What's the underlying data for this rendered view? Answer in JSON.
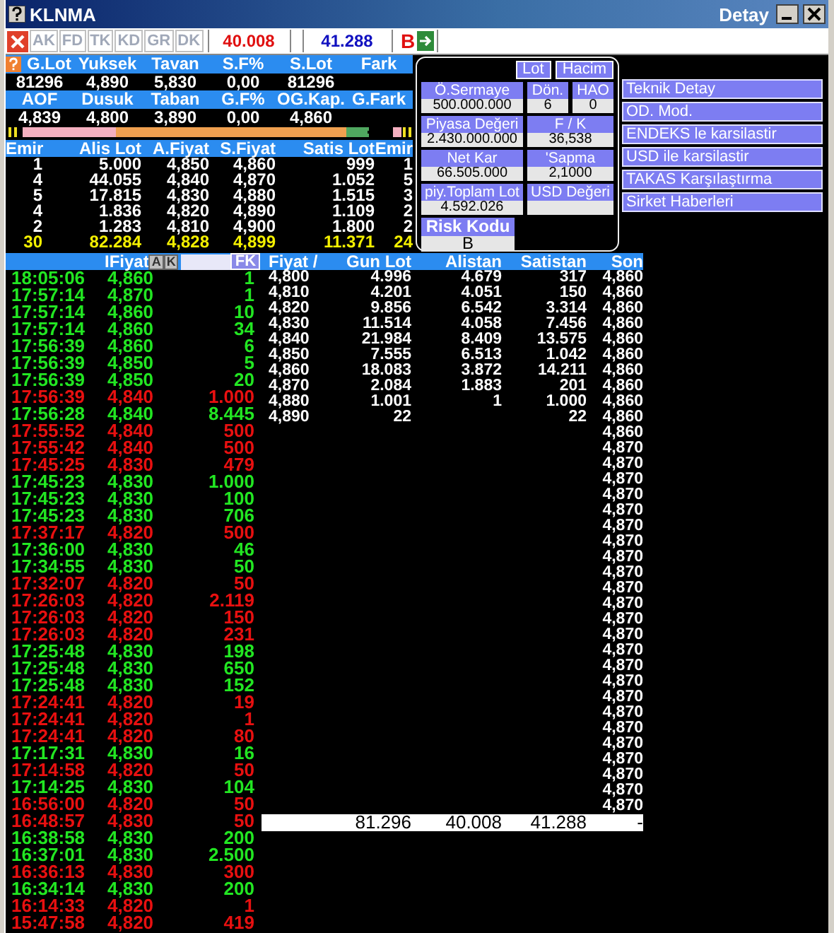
{
  "window": {
    "title": "KLNMA",
    "subtitle": "Detay"
  },
  "toolbar": {
    "tabs": [
      {
        "label": "AK",
        "disabled": true
      },
      {
        "label": "FD",
        "disabled": true
      },
      {
        "label": "TK",
        "disabled": true
      },
      {
        "label": "KD",
        "disabled": true
      },
      {
        "label": "GR",
        "disabled": true
      },
      {
        "label": "DK",
        "disabled": true
      }
    ],
    "bid_total": "40.008",
    "ask_total": "41.288",
    "flag": "B"
  },
  "summary": [
    {
      "headers": [
        "G.Lot",
        "Yuksek",
        "Tavan",
        "S.F%",
        "S.Lot",
        "Fark"
      ],
      "values": [
        "81296",
        "4,890",
        "5,830",
        "0,00",
        "81296"
      ]
    },
    {
      "headers": [
        "AOF",
        "Dusuk",
        "Taban",
        "G.F%",
        "OG.Kap.",
        "G.Fark"
      ],
      "values": [
        "4,839",
        "4,800",
        "3,890",
        "0,00",
        "4,860"
      ]
    }
  ],
  "order_book": {
    "columns": [
      "Emir",
      "Alis Lot",
      "A.Fiyat",
      "S.Fiyat",
      "Satis Lot",
      "Emir"
    ],
    "rows": [
      {
        "kind": "level",
        "cells": [
          "1",
          "5.000",
          "4,850",
          "4,860",
          "999",
          "1"
        ]
      },
      {
        "kind": "level",
        "cells": [
          "4",
          "44.055",
          "4,840",
          "4,870",
          "1.052",
          "5"
        ]
      },
      {
        "kind": "level",
        "cells": [
          "5",
          "17.815",
          "4,830",
          "4,880",
          "1.515",
          "3"
        ]
      },
      {
        "kind": "level",
        "cells": [
          "4",
          "1.836",
          "4,820",
          "4,890",
          "1.109",
          "2"
        ]
      },
      {
        "kind": "level",
        "cells": [
          "2",
          "1.283",
          "4,810",
          "4,900",
          "1.800",
          "2"
        ]
      },
      {
        "kind": "total",
        "cells": [
          "30",
          "82.284",
          "4,828",
          "4,899",
          "11.371",
          "24"
        ]
      }
    ]
  },
  "details": {
    "buttons": [
      "Lot",
      "Hacim"
    ],
    "rows": [
      [
        {
          "label": "Ö.Sermaye",
          "value": "500.000.000"
        },
        {
          "label": "Dön.",
          "value": "6"
        },
        {
          "label": "HAO",
          "value": "0"
        }
      ],
      [
        {
          "label": "Piyasa Değeri",
          "value": "2.430.000.000"
        },
        {
          "label": "F / K",
          "value": "36,538"
        }
      ],
      [
        {
          "label": "Net Kar",
          "value": "66.505.000"
        },
        {
          "label": "'Sapma",
          "value": "2,1000"
        }
      ],
      [
        {
          "label": "piy.Toplam Lot",
          "value": "4.592.026"
        },
        {
          "label": "USD Değeri"
        }
      ]
    ],
    "risk": {
      "label": "Risk Kodu",
      "value": "B"
    }
  },
  "links": [
    "Teknik Detay",
    "OD. Mod.",
    "ENDEKS le karsilastir",
    "USD ile karsilastir",
    "TAKAS Karşılaştırma",
    "Sirket Haberleri"
  ],
  "trades": {
    "header": "IFiyat",
    "buttons": [
      "A",
      "K"
    ],
    "filter_button": "FK",
    "rows": [
      {
        "time": "18:05:06",
        "price": "4,860",
        "lot": "1",
        "color": "#22e622"
      },
      {
        "time": "17:57:14",
        "price": "4,870",
        "lot": "1",
        "color": "#22e622"
      },
      {
        "time": "17:57:14",
        "price": "4,860",
        "lot": "10",
        "color": "#22e622"
      },
      {
        "time": "17:57:14",
        "price": "4,860",
        "lot": "34",
        "color": "#22e622"
      },
      {
        "time": "17:56:39",
        "price": "4,860",
        "lot": "6",
        "color": "#22e622"
      },
      {
        "time": "17:56:39",
        "price": "4,850",
        "lot": "5",
        "color": "#22e622"
      },
      {
        "time": "17:56:39",
        "price": "4,850",
        "lot": "20",
        "color": "#22e622"
      },
      {
        "time": "17:56:39",
        "price": "4,840",
        "lot": "1.000",
        "color": "#e81010"
      },
      {
        "time": "17:56:28",
        "price": "4,840",
        "lot": "8.445",
        "color": "#22e622"
      },
      {
        "time": "17:55:52",
        "price": "4,840",
        "lot": "500",
        "color": "#e81010"
      },
      {
        "time": "17:55:42",
        "price": "4,840",
        "lot": "500",
        "color": "#e81010"
      },
      {
        "time": "17:45:25",
        "price": "4,830",
        "lot": "479",
        "color": "#e81010"
      },
      {
        "time": "17:45:23",
        "price": "4,830",
        "lot": "1.000",
        "color": "#22e622"
      },
      {
        "time": "17:45:23",
        "price": "4,830",
        "lot": "100",
        "color": "#22e622"
      },
      {
        "time": "17:45:23",
        "price": "4,830",
        "lot": "706",
        "color": "#22e622"
      },
      {
        "time": "17:37:17",
        "price": "4,820",
        "lot": "500",
        "color": "#e81010"
      },
      {
        "time": "17:36:00",
        "price": "4,830",
        "lot": "46",
        "color": "#22e622"
      },
      {
        "time": "17:34:55",
        "price": "4,830",
        "lot": "50",
        "color": "#22e622"
      },
      {
        "time": "17:32:07",
        "price": "4,820",
        "lot": "50",
        "color": "#e81010"
      },
      {
        "time": "17:26:03",
        "price": "4,820",
        "lot": "2.119",
        "color": "#e81010"
      },
      {
        "time": "17:26:03",
        "price": "4,820",
        "lot": "150",
        "color": "#e81010"
      },
      {
        "time": "17:26:03",
        "price": "4,820",
        "lot": "231",
        "color": "#e81010"
      },
      {
        "time": "17:25:48",
        "price": "4,830",
        "lot": "198",
        "color": "#22e622"
      },
      {
        "time": "17:25:48",
        "price": "4,830",
        "lot": "650",
        "color": "#22e622"
      },
      {
        "time": "17:25:48",
        "price": "4,830",
        "lot": "152",
        "color": "#22e622"
      },
      {
        "time": "17:24:41",
        "price": "4,820",
        "lot": "19",
        "color": "#e81010"
      },
      {
        "time": "17:24:41",
        "price": "4,820",
        "lot": "1",
        "color": "#e81010"
      },
      {
        "time": "17:24:41",
        "price": "4,820",
        "lot": "80",
        "color": "#e81010"
      },
      {
        "time": "17:17:31",
        "price": "4,830",
        "lot": "16",
        "color": "#22e622"
      },
      {
        "time": "17:14:58",
        "price": "4,820",
        "lot": "50",
        "color": "#e81010"
      },
      {
        "time": "17:14:25",
        "price": "4,830",
        "lot": "104",
        "color": "#22e622"
      },
      {
        "time": "16:56:00",
        "price": "4,820",
        "lot": "50",
        "color": "#e81010"
      },
      {
        "time": "16:48:57",
        "price": "4,830",
        "lot": "50",
        "color": "#e81010"
      },
      {
        "time": "16:38:58",
        "price": "4,830",
        "lot": "200",
        "color": "#22e622"
      },
      {
        "time": "16:37:01",
        "price": "4,830",
        "lot": "2.500",
        "color": "#22e622"
      },
      {
        "time": "16:36:13",
        "price": "4,830",
        "lot": "300",
        "color": "#e81010"
      },
      {
        "time": "16:34:14",
        "price": "4,830",
        "lot": "200",
        "color": "#22e622"
      },
      {
        "time": "16:14:33",
        "price": "4,820",
        "lot": "1",
        "color": "#e81010"
      },
      {
        "time": "15:47:58",
        "price": "4,820",
        "lot": "419",
        "color": "#e81010"
      }
    ]
  },
  "depth": {
    "columns": [
      "Fiyat /",
      "Gun Lot",
      "Alistan",
      "Satistan",
      "Son"
    ],
    "rows": [
      [
        "4,800",
        "4.996",
        "4.679",
        "317"
      ],
      [
        "4,810",
        "4.201",
        "4.051",
        "150"
      ],
      [
        "4,820",
        "9.856",
        "6.542",
        "3.314"
      ],
      [
        "4,830",
        "11.514",
        "4.058",
        "7.456"
      ],
      [
        "4,840",
        "21.984",
        "8.409",
        "13.575"
      ],
      [
        "4,850",
        "7.555",
        "6.513",
        "1.042"
      ],
      [
        "4,860",
        "18.083",
        "3.872",
        "14.211"
      ],
      [
        "4,870",
        "2.084",
        "1.883",
        "201"
      ],
      [
        "4,880",
        "1.001",
        "1",
        "1.000"
      ],
      [
        "4,890",
        "22",
        "",
        "22"
      ]
    ],
    "son": [
      "4,860",
      "4,860",
      "4,860",
      "4,860",
      "4,860",
      "4,860",
      "4,860",
      "4,860",
      "4,860",
      "4,860",
      "4,860",
      "4,870",
      "4,870",
      "4,870",
      "4,870",
      "4,870",
      "4,870",
      "4,870",
      "4,870",
      "4,870",
      "4,870",
      "4,870",
      "4,870",
      "4,870",
      "4,870",
      "4,870",
      "4,870",
      "4,870",
      "4,870",
      "4,870",
      "4,870",
      "4,870",
      "4,870",
      "4,870",
      "4,870"
    ],
    "totals": [
      "81.296",
      "40.008",
      "41.288",
      "-"
    ]
  }
}
